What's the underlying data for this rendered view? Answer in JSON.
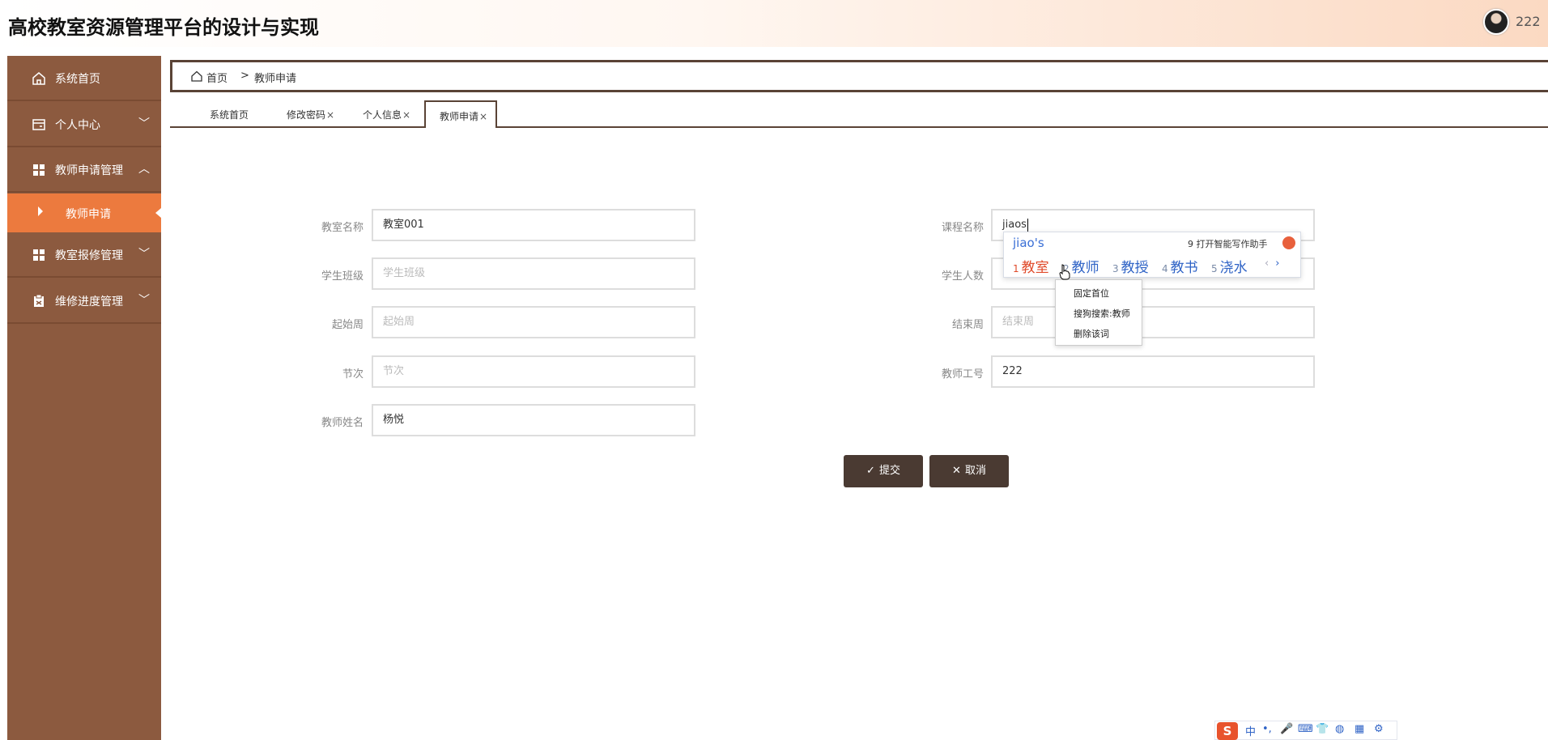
{
  "header": {
    "title": "高校教室资源管理平台的设计与实现",
    "username": "222"
  },
  "sidebar": {
    "items": [
      {
        "label": "系统首页",
        "icon": "home-icon"
      },
      {
        "label": "个人中心",
        "icon": "wallet-icon",
        "chevron": "﹀"
      },
      {
        "label": "教师申请管理",
        "icon": "grid-icon",
        "chevron": "︿"
      },
      {
        "label": "教室报修管理",
        "icon": "grid-icon",
        "chevron": "﹀"
      },
      {
        "label": "维修进度管理",
        "icon": "clipboard-icon",
        "chevron": "﹀"
      }
    ],
    "active_sub": "教师申请"
  },
  "breadcrumb": {
    "home": "首页",
    "separator": ">",
    "current": "教师申请"
  },
  "tabs": [
    {
      "label": "系统首页",
      "closable": false
    },
    {
      "label": "修改密码",
      "closable": true
    },
    {
      "label": "个人信息",
      "closable": true
    },
    {
      "label": "教师申请",
      "closable": true,
      "active": true
    }
  ],
  "tab_close": "×",
  "form": {
    "left": [
      {
        "label": "教室名称",
        "value": "教室001",
        "placeholder": ""
      },
      {
        "label": "学生班级",
        "value": "",
        "placeholder": "学生班级"
      },
      {
        "label": "起始周",
        "value": "",
        "placeholder": "起始周"
      },
      {
        "label": "节次",
        "value": "",
        "placeholder": "节次"
      },
      {
        "label": "教师姓名",
        "value": "杨悦",
        "placeholder": ""
      }
    ],
    "right": [
      {
        "label": "课程名称",
        "value": "jiaos",
        "placeholder": ""
      },
      {
        "label": "学生人数",
        "value": "",
        "placeholder": ""
      },
      {
        "label": "结束周",
        "value": "",
        "placeholder": "结束周"
      },
      {
        "label": "教师工号",
        "value": "222",
        "placeholder": ""
      }
    ],
    "submit_label": "提交",
    "cancel_label": "取消"
  },
  "ime": {
    "composition": "jiao's",
    "assist_label": "9 打开智能写作助手",
    "candidates": [
      {
        "n": "1",
        "text": "教室"
      },
      {
        "n": "2",
        "text": "教师"
      },
      {
        "n": "3",
        "text": "教授"
      },
      {
        "n": "4",
        "text": "教书"
      },
      {
        "n": "5",
        "text": "浇水"
      }
    ],
    "prev": "‹",
    "next": "›",
    "context_menu": [
      "固定首位",
      "搜狗搜索:教师",
      "删除该词"
    ],
    "toolbar": [
      "中",
      "•,",
      "🎤",
      "⌨",
      "👕",
      "◍",
      "▦",
      "⚙"
    ],
    "toolbar_logo": "S"
  },
  "colors": {
    "sidebar_bg": "#8c5a3f",
    "sidebar_active": "#ec7a3e",
    "accent_dark": "#4a3a32"
  }
}
